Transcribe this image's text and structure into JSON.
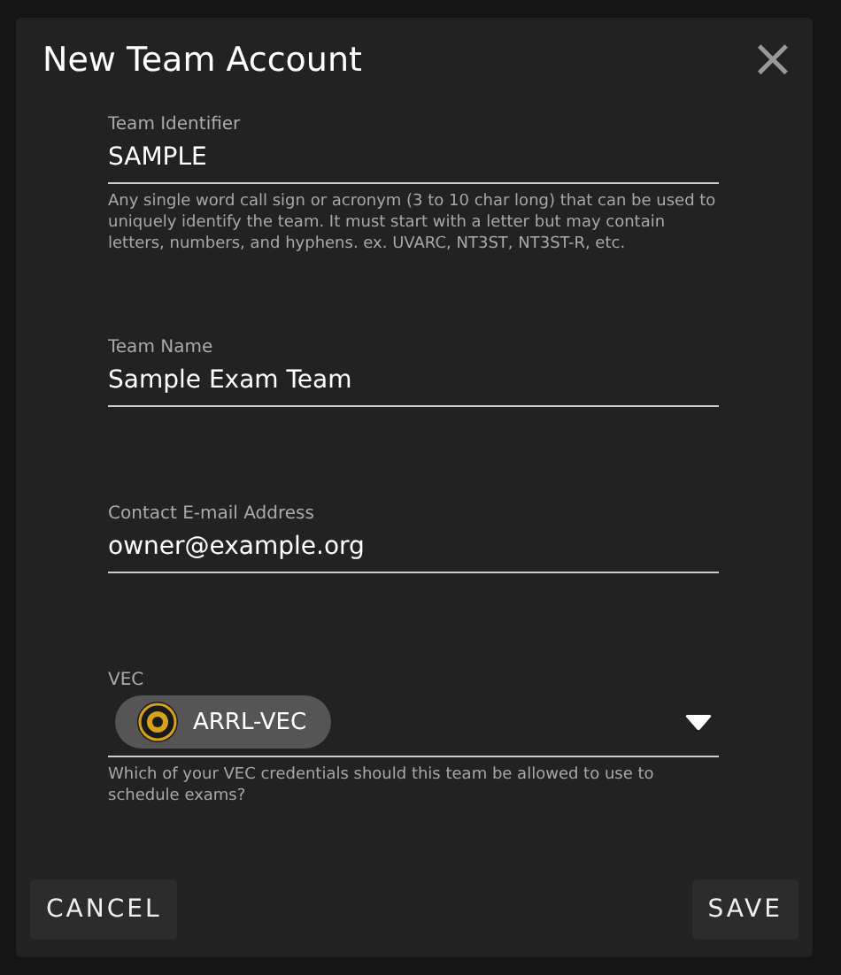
{
  "dialog": {
    "title": "New Team Account",
    "close": "×"
  },
  "fields": [
    {
      "kind": "text",
      "label": "Team Identifier",
      "value": "SAMPLE",
      "helper": "Any single word call sign or acronym (3 to 10 char long) that can be used to uniquely identify the team. It must start with a letter but may contain letters, numbers, and hyphens. ex. UVARC, NT3ST, NT3ST-R, etc."
    },
    {
      "kind": "text",
      "label": "Team Name",
      "value": "Sample Exam Team"
    },
    {
      "kind": "text",
      "label": "Contact E-mail Address",
      "value": "owner@example.org"
    },
    {
      "kind": "select",
      "label": "VEC",
      "chips": [
        "ARRL-VEC"
      ],
      "helper": "Which of your VEC credentials should this team be allowed to use to schedule exams?"
    }
  ],
  "buttons": [
    {
      "label": "CANCEL",
      "kind": "cancel"
    },
    {
      "label": "SAVE",
      "kind": "save"
    }
  ]
}
